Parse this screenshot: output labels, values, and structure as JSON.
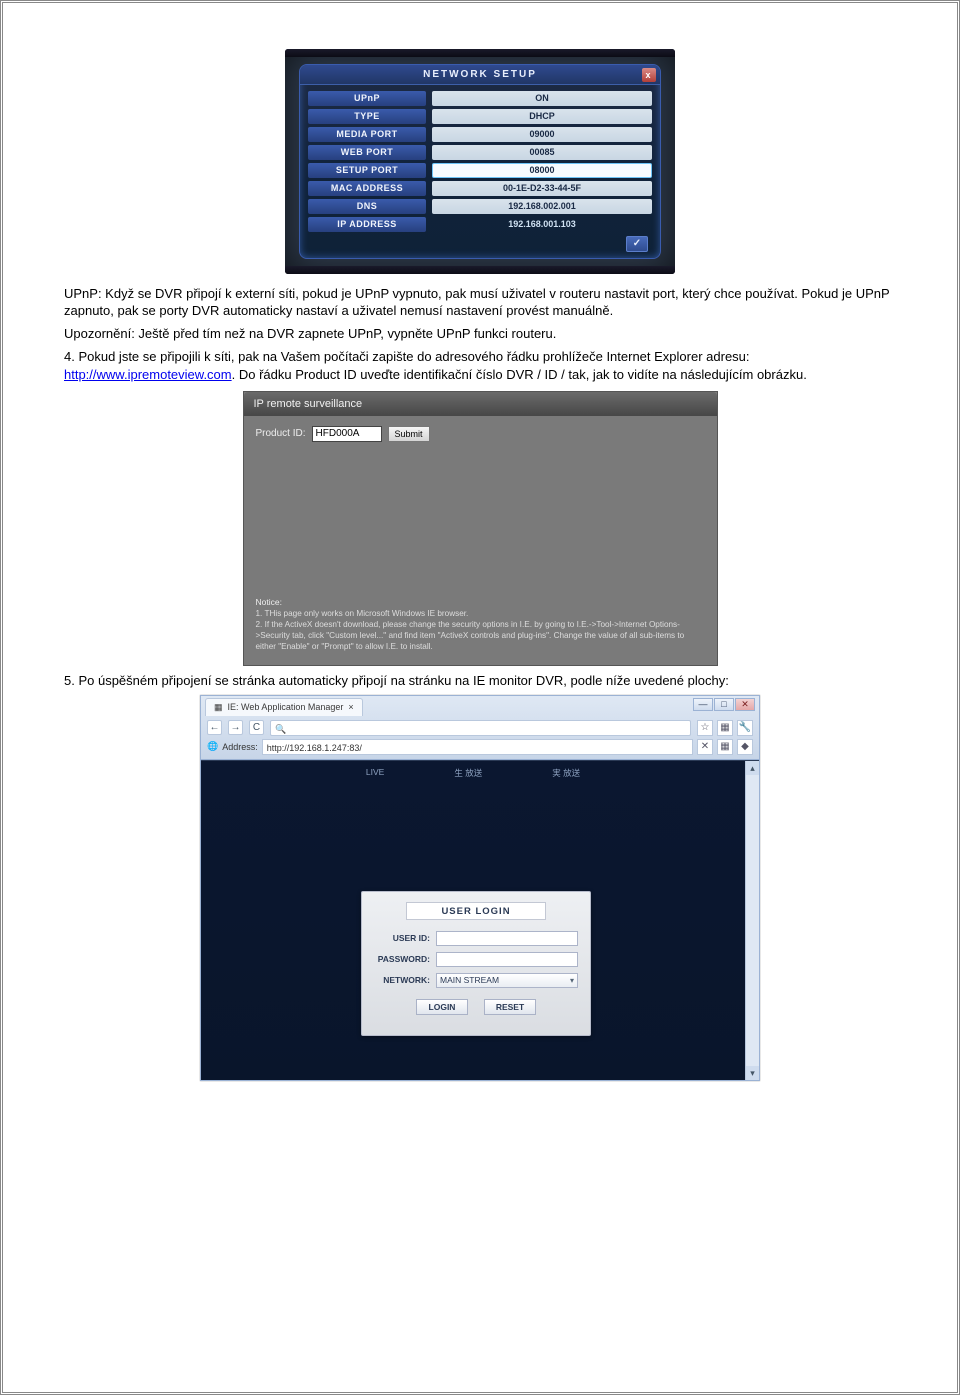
{
  "screenshot1": {
    "title": "NETWORK SETUP",
    "close": "x",
    "footer_btn": "✓",
    "rows": [
      {
        "label": "UPnP",
        "value": "ON"
      },
      {
        "label": "TYPE",
        "value": "DHCP"
      },
      {
        "label": "MEDIA PORT",
        "value": "09000"
      },
      {
        "label": "WEB PORT",
        "value": "00085"
      },
      {
        "label": "SETUP PORT",
        "value": "08000"
      },
      {
        "label": "MAC ADDRESS",
        "value": "00-1E-D2-33-44-5F"
      },
      {
        "label": "DNS",
        "value": "192.168.002.001"
      },
      {
        "label": "IP ADDRESS",
        "value": "192.168.001.103"
      }
    ]
  },
  "para1a": "UPnP: Když se DVR připojí k externí síti, pokud je UPnP vypnuto, pak musí uživatel v routeru nastavit port, který chce používat. Pokud je UPnP zapnuto, pak se porty DVR automaticky nastaví a uživatel nemusí nastavení provést manuálně.",
  "para1b": "Upozornění: Ještě před tím než na DVR zapnete UPnP, vypněte UPnP funkci routeru.",
  "para1c_pre": "4. Pokud jste se připojili k síti, pak na Vašem počítači zapište do adresového řádku prohlížeče Internet Explorer adresu: ",
  "para1c_link": "http://www.ipremoteview.com",
  "para1c_post": ". Do řádku Product ID uveďte identifikační číslo DVR / ID / tak, jak to vidíte na následujícím obrázku.",
  "screenshot2": {
    "title": "IP remote surveillance",
    "product_label": "Product ID:",
    "product_value": "HFD000A",
    "submit": "Submit",
    "notice_hd": "Notice:",
    "notice_1": "1. THis page only works on Microsoft Windows IE browser.",
    "notice_2": "2. If the ActiveX doesn't download, please change the security options in I.E. by going to I.E.->Tool->Internet Options->Security tab, click \"Custom level...\" and find item \"ActiveX controls and plug-ins\". Change the value of all sub-items to either \"Enable\" or \"Prompt\" to allow I.E. to install."
  },
  "para2": "5. Po úspěšném připojení se stránka automaticky připojí na stránku na IE monitor DVR, podle níže uvedené plochy:",
  "screenshot3": {
    "tab_title": "IE: Web Application Manager",
    "win_min": "—",
    "win_max": "□",
    "win_close": "✕",
    "nav_back": "←",
    "nav_fwd": "→",
    "nav_reload": "C",
    "nav_search": "🔍",
    "star": "☆",
    "plugin": "▦",
    "wrench": "🔧",
    "addr_label": "Address:",
    "addr_value": "http://192.168.1.247:83/",
    "body_tabs": [
      "LIVE",
      "生 放送",
      "実 放送"
    ],
    "login_title": "USER LOGIN",
    "user_label": "USER ID:",
    "pass_label": "PASSWORD:",
    "net_label": "NETWORK:",
    "net_value": "MAIN STREAM",
    "btn_login": "LOGIN",
    "btn_reset": "RESET",
    "scroll_up": "▴",
    "scroll_down": "▾"
  }
}
